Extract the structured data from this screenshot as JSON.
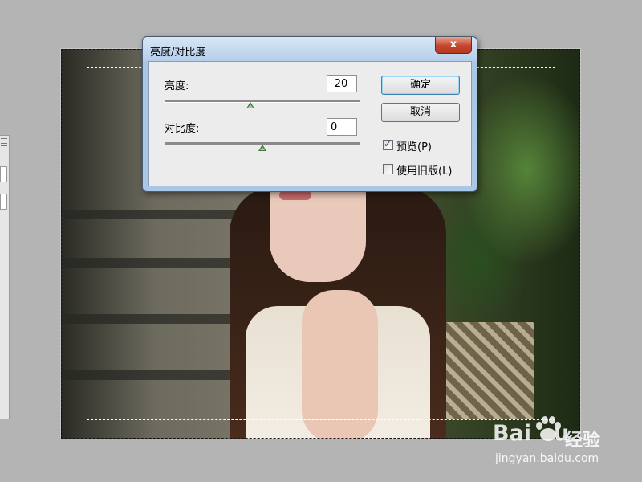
{
  "dialog": {
    "title": "亮度/对比度",
    "close_label": "x",
    "brightness": {
      "label": "亮度:",
      "value": "-20"
    },
    "contrast": {
      "label": "对比度:",
      "value": "0"
    },
    "ok_label": "确定",
    "cancel_label": "取消",
    "preview": {
      "label": "预览(P)",
      "checked": true
    },
    "legacy": {
      "label": "使用旧版(L)",
      "checked": false
    }
  },
  "watermark": {
    "logo": "Bai",
    "logo_tail": "u",
    "cn": "经验",
    "url": "jingyan.baidu.com"
  },
  "colors": {
    "close_red": "#c4452c",
    "thumb_green": "#3f7a3f",
    "frame_blue": "#a9c7e6"
  }
}
